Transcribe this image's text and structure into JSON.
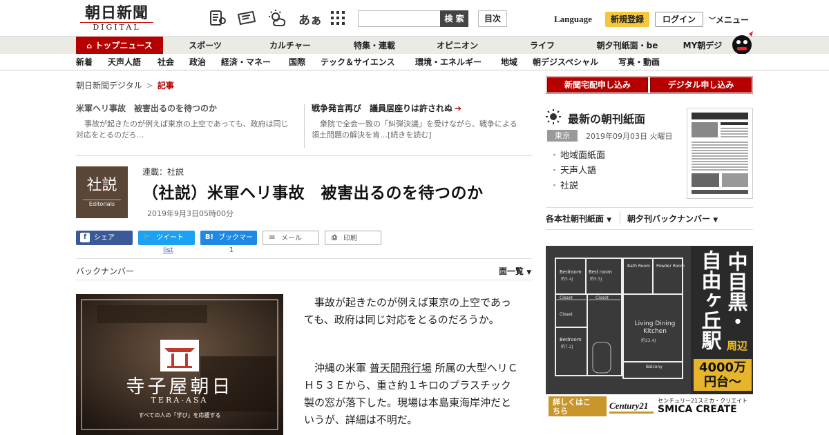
{
  "header": {
    "logo_jp": "朝日新聞",
    "logo_en": "DIGITAL",
    "icons": [
      "newspaper-icon",
      "coupon-icon",
      "weather-icon",
      "font-size-icon",
      "grid-icon"
    ],
    "font_size_label": "あぁ",
    "search_placeholder": "",
    "search_button": "検 索",
    "toc_button": "目次",
    "language": "Language",
    "register": "新規登録",
    "login": "ログイン",
    "menu": "メニュー"
  },
  "nav_main": [
    {
      "label": "トップニュース",
      "active": true
    },
    {
      "label": "スポーツ"
    },
    {
      "label": "カルチャー"
    },
    {
      "label": "特集・連載"
    },
    {
      "label": "オピニオン"
    },
    {
      "label": "ライフ"
    },
    {
      "label": "朝夕刊紙面・be"
    },
    {
      "label": "MY朝デジ"
    }
  ],
  "nav_sub": [
    "新着",
    "天声人語",
    "社会",
    "政治",
    "経済・マネー",
    "国際",
    "テック＆サイエンス",
    "環境・エネルギー",
    "地域",
    "朝デジスペシャル",
    "写真・動画"
  ],
  "breadcrumb": {
    "home": "朝日新聞デジタル",
    "sep": ">",
    "current": "記事"
  },
  "related": [
    {
      "title": "米軍ヘリ事故　被害出るのを待つのか",
      "summary": "事故が起きたのが例えば東京の上空であっても、政府は同じ対応をとるのだろ…"
    },
    {
      "title": "戦争発言再び　議員居座りは許されぬ",
      "arrow": "➔",
      "summary": "衆院で全会一致の「糾弾決議」を受けながら、戦争による領土問題の解決を肯…[続きを読む]"
    }
  ],
  "article": {
    "thumb_kanji": "社説",
    "thumb_en": "Editorials",
    "series": "連載：社説",
    "title": "（社説）米軍ヘリ事故　被害出るのを待つのか",
    "date": "2019年9月3日05時00分",
    "share": {
      "facebook": "シェア",
      "twitter": "ツイート",
      "hatena": "ブックマーク",
      "mail": "メール",
      "print": "印刷"
    },
    "twitter_count": "list",
    "hatena_count": "1",
    "backnumber": "バックナンバー",
    "page_list": "面一覧",
    "paragraphs": [
      "事故が起きたのが例えば東京の上空であっても、政府は同じ対応をとるのだろうか。",
      "沖縄の米軍 普天間飛行場 所属の大型ヘリＣＨ５３Ｅから、重さ約１キロのプラスチック製の窓が落下した。現場は本島東海岸沖だというが、詳細は不明だ。"
    ],
    "link_text": "普天間飛行場"
  },
  "promo": {
    "title": "寺子屋朝日",
    "subtitle": "TERA-ASA",
    "tagline": "すべての人の「学び」を応援する"
  },
  "sidebar": {
    "subscribe_home": "新聞宅配申し込み",
    "subscribe_digital": "デジタル申し込み",
    "latest_title": "最新の朝刊紙面",
    "region": "東京",
    "date": "2019年09月03日 火曜日",
    "links": [
      "地域面紙面",
      "天声人語",
      "社説"
    ],
    "select1": "各本社朝刊紙面",
    "select2": "朝夕刊バックナンバー"
  },
  "ad": {
    "station": "中目黒・自由ヶ丘駅",
    "col1": "中目黒・",
    "col2": "自由ヶ丘駅",
    "area": "周辺",
    "price": "4000万円台～",
    "price1": "4000万",
    "price2": "円台～",
    "detail": "詳しくはこちら",
    "brand": "Century21",
    "company_jp": "センチュリー21スミカ・クリエイト",
    "company_en": "SMICA CREATE",
    "rooms": [
      "Bedroom",
      "Bed room",
      "Bath Room",
      "Powder Room",
      "Closet",
      "Closet",
      "Closet",
      "Bedroom",
      "Living Dining Kitchen",
      "Balcony"
    ],
    "sizes": [
      "約5.4J",
      "約5.5J",
      "約7.2J",
      "約22.4J"
    ]
  },
  "colors": {
    "brand_red": "#b60000",
    "accent_yellow": "#f5c73d",
    "nav_bg": "#eceae5"
  }
}
